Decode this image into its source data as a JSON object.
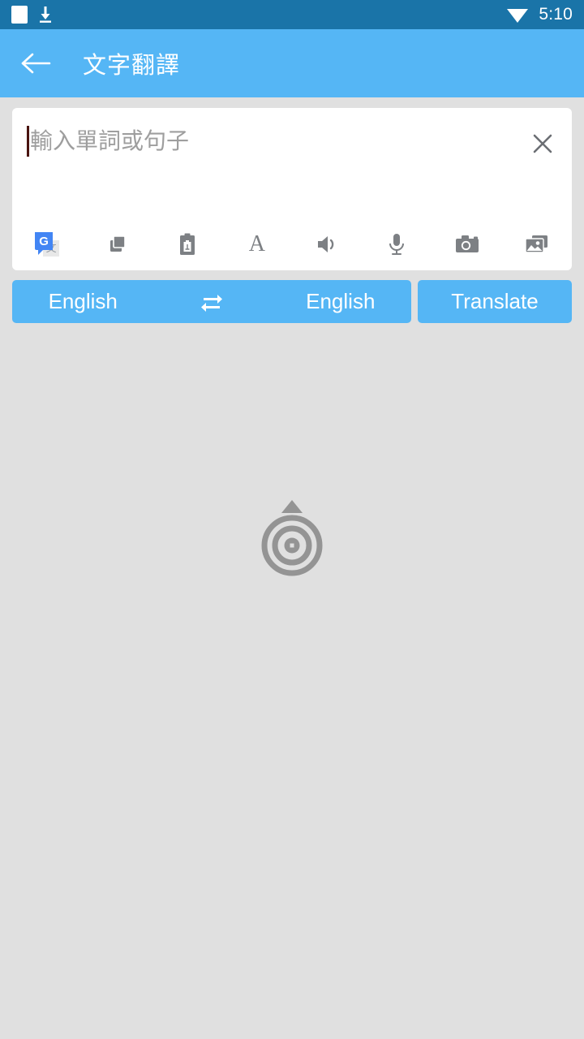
{
  "status_bar": {
    "icons": [
      "white-square-icon",
      "download-icon",
      "wifi-icon"
    ],
    "time": "5:10",
    "background_color": "#1a74a8"
  },
  "toolbar": {
    "back_label": "back-arrow-icon",
    "title": "文字翻譯",
    "background_color": "#55b6f5"
  },
  "input_card": {
    "placeholder": "輸入單詞或句子",
    "value": "",
    "clear_label": "×",
    "tools": [
      {
        "name": "google-translate-icon",
        "blue_letter": "G",
        "grey_letter": "文"
      },
      {
        "name": "copy-icon"
      },
      {
        "name": "paste-icon"
      },
      {
        "name": "font-icon",
        "glyph": "A"
      },
      {
        "name": "speaker-icon"
      },
      {
        "name": "microphone-icon"
      },
      {
        "name": "camera-icon"
      },
      {
        "name": "gallery-icon"
      }
    ]
  },
  "language_bar": {
    "source_language": "English",
    "swap_icon": "swap-arrows-icon",
    "target_language": "English",
    "translate_label": "Translate",
    "accent_color": "#55b6f5"
  },
  "watermark": {
    "icon": "target-bullseye-icon",
    "color": "#949494"
  },
  "background_color": "#e0e0e0"
}
